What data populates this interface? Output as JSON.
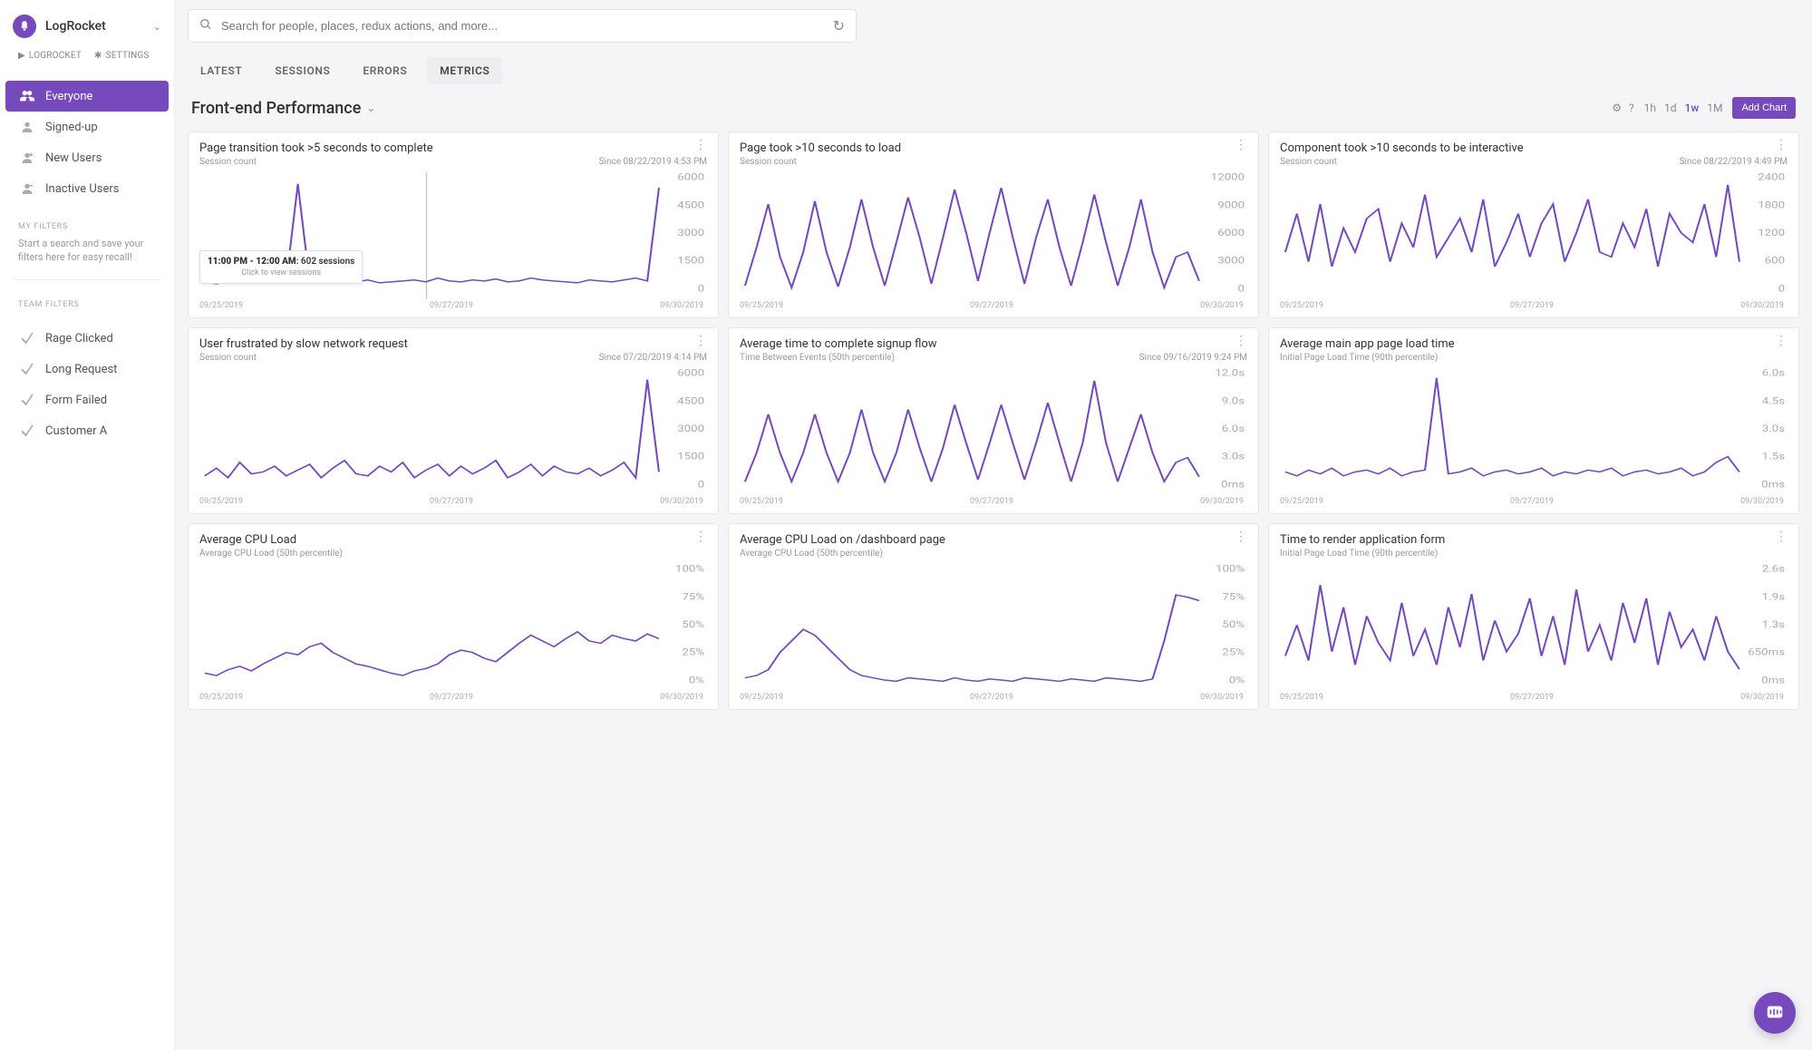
{
  "brand": {
    "name": "LogRocket"
  },
  "search": {
    "placeholder": "Search for people, places, redux actions, and more..."
  },
  "side_mini": {
    "logrocket": "LOGROCKET",
    "settings": "SETTINGS"
  },
  "sidebar": {
    "items": [
      {
        "label": "Everyone"
      },
      {
        "label": "Signed-up"
      },
      {
        "label": "New Users"
      },
      {
        "label": "Inactive Users"
      }
    ],
    "my_filters_label": "MY FILTERS",
    "my_filters_hint": "Start a search and save your filters here for easy recall!",
    "team_filters_label": "TEAM FILTERS",
    "team_items": [
      {
        "label": "Rage Clicked"
      },
      {
        "label": "Long Request"
      },
      {
        "label": "Form Failed"
      },
      {
        "label": "Customer A"
      }
    ]
  },
  "tabs": [
    "LATEST",
    "SESSIONS",
    "ERRORS",
    "METRICS"
  ],
  "active_tab": "METRICS",
  "page_title": "Front-end Performance",
  "time_range": [
    "1h",
    "1d",
    "1w",
    "1M"
  ],
  "active_time_range": "1w",
  "add_chart": "Add Chart",
  "tooltip": {
    "title": "11:00 PM - 12:00 AM",
    "value": "602 sessions",
    "sub": "Click to view sessions"
  },
  "charts": [
    {
      "title": "Page transition took >5 seconds to complete",
      "subtitle": "Session count",
      "since": "Since 08/22/2019 4:53 PM",
      "y_ticks": [
        "6000",
        "4500",
        "3000",
        "1500",
        "0"
      ],
      "x_ticks": [
        "09/25/2019",
        "09/27/2019",
        "09/30/2019"
      ]
    },
    {
      "title": "Page took >10 seconds to load",
      "subtitle": "Session count",
      "since": "",
      "y_ticks": [
        "12000",
        "9000",
        "6000",
        "3000",
        "0"
      ],
      "x_ticks": [
        "09/25/2019",
        "09/27/2019",
        "09/30/2019"
      ]
    },
    {
      "title": "Component took >10 seconds to be interactive",
      "subtitle": "Session count",
      "since": "Since 08/22/2019 4:49 PM",
      "y_ticks": [
        "2400",
        "1800",
        "1200",
        "600",
        "0"
      ],
      "x_ticks": [
        "09/25/2019",
        "09/27/2019",
        "09/30/2019"
      ]
    },
    {
      "title": "User frustrated by slow network request",
      "subtitle": "Session count",
      "since": "Since 07/20/2019 4:14 PM",
      "y_ticks": [
        "6000",
        "4500",
        "3000",
        "1500",
        "0"
      ],
      "x_ticks": [
        "09/25/2019",
        "09/27/2019",
        "09/30/2019"
      ]
    },
    {
      "title": "Average time to complete signup flow",
      "subtitle": "Time Between Events (50th percentile)",
      "since": "Since 09/16/2019 9:24 PM",
      "y_ticks": [
        "12.0s",
        "9.0s",
        "6.0s",
        "3.0s",
        "0ms"
      ],
      "x_ticks": [
        "09/25/2019",
        "09/27/2019",
        "09/30/2019"
      ]
    },
    {
      "title": "Average main app page load time",
      "subtitle": "Initial Page Load Time (90th percentile)",
      "since": "",
      "y_ticks": [
        "6.0s",
        "4.5s",
        "3.0s",
        "1.5s",
        "0ms"
      ],
      "x_ticks": [
        "09/25/2019",
        "09/27/2019",
        "09/30/2019"
      ]
    },
    {
      "title": "Average CPU Load",
      "subtitle": "Average CPU Load (50th percentile)",
      "since": "",
      "y_ticks": [
        "100%",
        "75%",
        "50%",
        "25%",
        "0%"
      ],
      "x_ticks": [
        "09/25/2019",
        "09/27/2019",
        "09/30/2019"
      ]
    },
    {
      "title": "Average CPU Load on /dashboard page",
      "subtitle": "Average CPU Load (50th percentile)",
      "since": "",
      "y_ticks": [
        "100%",
        "75%",
        "50%",
        "25%",
        "0%"
      ],
      "x_ticks": [
        "09/25/2019",
        "09/27/2019",
        "09/30/2019"
      ]
    },
    {
      "title": "Time to render application form",
      "subtitle": "Initial Page Load Time (90th percentile)",
      "since": "",
      "y_ticks": [
        "2.6s",
        "1.9s",
        "1.3s",
        "650ms",
        "0ms"
      ],
      "x_ticks": [
        "09/25/2019",
        "09/27/2019",
        "09/30/2019"
      ]
    }
  ],
  "chart_data": [
    {
      "type": "line",
      "ylabel": "Session count",
      "ylim": [
        0,
        6000
      ],
      "x": [
        "09/25/2019",
        "09/27/2019",
        "09/30/2019"
      ],
      "values": [
        700,
        600,
        750,
        800,
        650,
        700,
        900,
        750,
        5800,
        700,
        650,
        800,
        750,
        700,
        800,
        650,
        700,
        750,
        800,
        700,
        900,
        750,
        700,
        800,
        750,
        850,
        700,
        750,
        900,
        800,
        750,
        700,
        650,
        800,
        750,
        700,
        800,
        900,
        750,
        5600
      ]
    },
    {
      "type": "line",
      "ylabel": "Session count",
      "ylim": [
        0,
        12000
      ],
      "x": [
        "09/25/2019",
        "09/27/2019",
        "09/30/2019"
      ],
      "values": [
        1000,
        5000,
        9500,
        4000,
        800,
        4500,
        9800,
        4500,
        900,
        5000,
        10000,
        5000,
        1000,
        5500,
        10200,
        6000,
        1200,
        6000,
        11000,
        6500,
        1500,
        6500,
        11200,
        6000,
        1200,
        6000,
        10000,
        5000,
        1000,
        5500,
        10500,
        5500,
        1000,
        5000,
        10000,
        4500,
        800,
        4000,
        4500,
        1500
      ]
    },
    {
      "type": "line",
      "ylabel": "Session count",
      "ylim": [
        0,
        2400
      ],
      "x": [
        "09/25/2019",
        "09/27/2019",
        "09/30/2019"
      ],
      "values": [
        900,
        1700,
        700,
        1900,
        600,
        1400,
        900,
        1600,
        1800,
        700,
        1500,
        1000,
        2100,
        800,
        1200,
        1600,
        900,
        2000,
        600,
        1100,
        1700,
        800,
        1500,
        1900,
        700,
        1300,
        2000,
        900,
        800,
        1500,
        1000,
        1800,
        600,
        1700,
        1300,
        1100,
        1900,
        800,
        2300,
        700
      ]
    },
    {
      "type": "line",
      "ylabel": "Session count",
      "ylim": [
        0,
        6000
      ],
      "x": [
        "09/25/2019",
        "09/27/2019",
        "09/30/2019"
      ],
      "values": [
        800,
        1200,
        700,
        1500,
        900,
        1000,
        1300,
        800,
        1100,
        1400,
        700,
        1200,
        1600,
        900,
        800,
        1300,
        1000,
        1500,
        700,
        1100,
        1400,
        800,
        1300,
        900,
        1200,
        1600,
        700,
        1000,
        1400,
        800,
        1300,
        1000,
        900,
        1200,
        800,
        1100,
        1500,
        700,
        5800,
        1000
      ]
    },
    {
      "type": "line",
      "ylabel": "Time Between Events (50th percentile)",
      "ylim": [
        0,
        12
      ],
      "x": [
        "09/25/2019",
        "09/27/2019",
        "09/30/2019"
      ],
      "values": [
        1,
        4,
        8,
        4,
        1,
        4,
        8,
        4,
        1,
        4,
        8.5,
        4,
        1,
        4,
        8.5,
        4.5,
        1,
        4.5,
        9,
        5,
        1.2,
        5,
        9,
        5,
        1.2,
        5,
        9.2,
        5,
        1,
        5,
        11.5,
        5,
        1,
        4.5,
        8,
        4,
        1,
        3,
        3.5,
        1.5
      ]
    },
    {
      "type": "line",
      "ylabel": "Initial Page Load Time (90th percentile)",
      "ylim": [
        0,
        6
      ],
      "x": [
        "09/25/2019",
        "09/27/2019",
        "09/30/2019"
      ],
      "values": [
        1.0,
        0.8,
        1.1,
        0.9,
        1.2,
        0.8,
        1.0,
        1.1,
        0.9,
        1.2,
        0.8,
        1.0,
        1.1,
        5.9,
        0.9,
        1.0,
        1.2,
        0.8,
        1.0,
        1.1,
        0.9,
        1.0,
        1.2,
        0.8,
        1.0,
        0.9,
        1.1,
        1.0,
        1.2,
        0.8,
        1.0,
        1.1,
        0.9,
        1.0,
        1.2,
        0.8,
        1.0,
        1.5,
        1.8,
        1.0
      ]
    },
    {
      "type": "line",
      "ylabel": "Average CPU Load (50th percentile)",
      "ylim": [
        0,
        100
      ],
      "x": [
        "09/25/2019",
        "09/27/2019",
        "09/30/2019"
      ],
      "values": [
        12,
        10,
        15,
        18,
        14,
        20,
        25,
        30,
        28,
        35,
        38,
        30,
        25,
        20,
        18,
        15,
        12,
        10,
        14,
        16,
        20,
        28,
        32,
        30,
        25,
        22,
        30,
        38,
        45,
        40,
        35,
        42,
        48,
        40,
        38,
        45,
        42,
        40,
        46,
        42
      ]
    },
    {
      "type": "line",
      "ylabel": "Average CPU Load (50th percentile)",
      "ylim": [
        0,
        100
      ],
      "x": [
        "09/25/2019",
        "09/27/2019",
        "09/30/2019"
      ],
      "values": [
        8,
        10,
        15,
        30,
        40,
        50,
        45,
        35,
        25,
        15,
        10,
        8,
        6,
        5,
        8,
        7,
        6,
        5,
        8,
        6,
        5,
        7,
        6,
        5,
        8,
        7,
        6,
        5,
        7,
        6,
        5,
        8,
        7,
        6,
        5,
        7,
        40,
        80,
        78,
        75
      ]
    },
    {
      "type": "line",
      "ylabel": "Initial Page Load Time (90th percentile)",
      "ylim": [
        0,
        2.6
      ],
      "x": [
        "09/25/2019",
        "09/27/2019",
        "09/30/2019"
      ],
      "values": [
        0.7,
        1.4,
        0.6,
        2.3,
        0.8,
        1.8,
        0.5,
        1.6,
        1.0,
        0.6,
        1.9,
        0.7,
        1.3,
        0.5,
        1.8,
        0.9,
        2.1,
        0.6,
        1.5,
        0.8,
        1.2,
        2.0,
        0.7,
        1.6,
        0.5,
        2.2,
        0.8,
        1.4,
        0.6,
        1.9,
        1.0,
        2.0,
        0.5,
        1.7,
        0.9,
        1.3,
        0.6,
        1.6,
        0.8,
        0.4
      ]
    }
  ]
}
